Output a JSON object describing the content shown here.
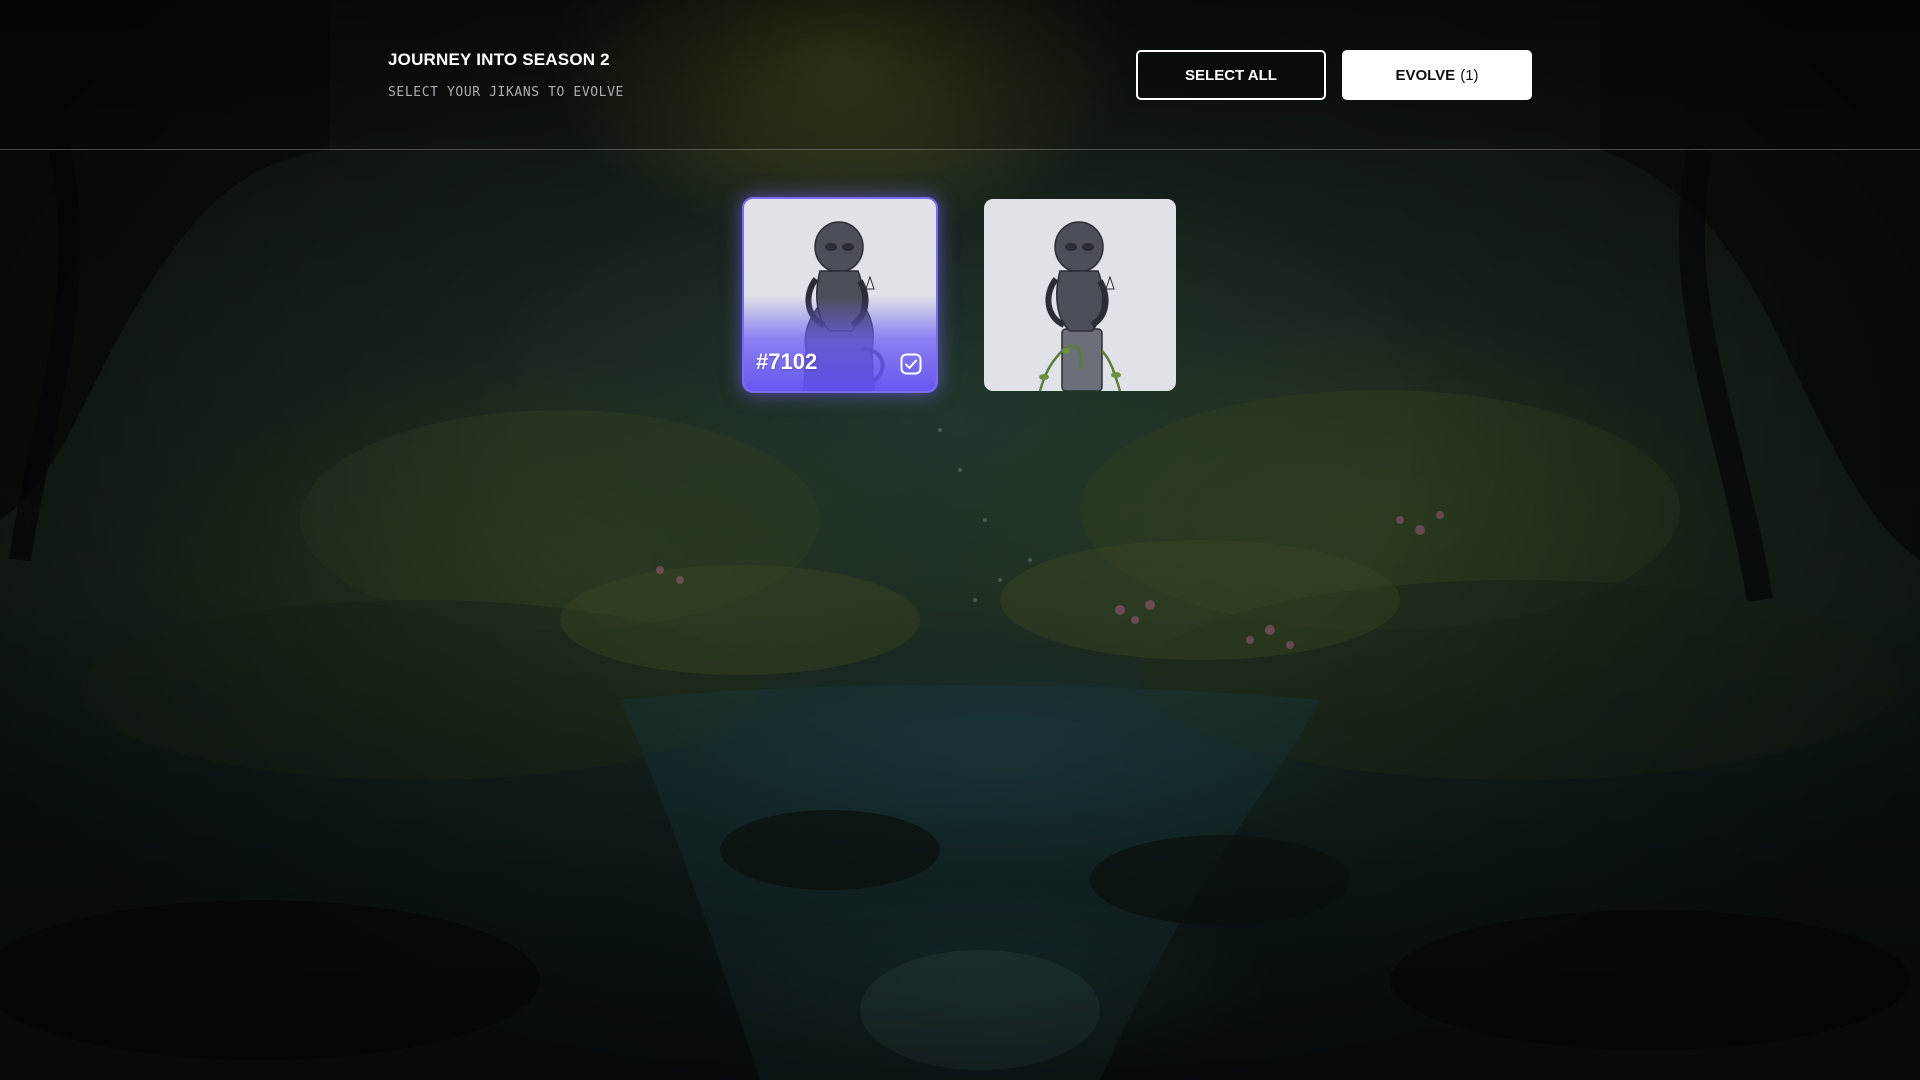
{
  "header": {
    "title": "JOURNEY INTO SEASON 2",
    "subtitle": "SELECT YOUR JIKANS TO EVOLVE",
    "select_all_label": "SELECT ALL",
    "evolve_label": "EVOLVE",
    "evolve_count": "(1)"
  },
  "cards": [
    {
      "token_id": "#7102",
      "selected": true,
      "icon": "checkbox-checked-icon"
    },
    {
      "token_id": "",
      "selected": false
    }
  ],
  "colors": {
    "accent": "#7a6cf0",
    "card_bg": "#dfe3e8",
    "button_primary_bg": "#ffffff"
  }
}
